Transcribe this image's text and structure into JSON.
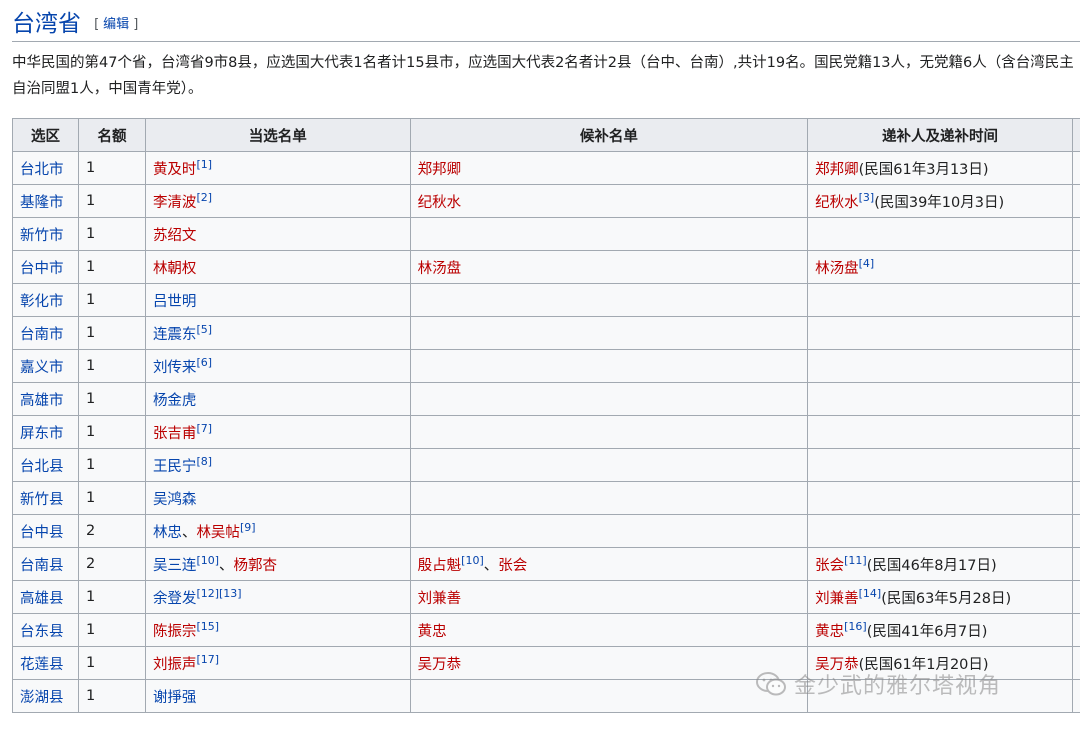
{
  "heading": {
    "title": "台湾省",
    "edit_open": "[",
    "edit_label": "编辑",
    "edit_close": "]"
  },
  "intro": "中华民国的第47个省，台湾省9市8县，应选国大代表1名者计15县市，应选国大代表2名者计2县（台中、台南）,共计19名。国民党籍13人，无党籍6人（含台湾民主自治同盟1人，中国青年党）。",
  "table": {
    "headers": [
      "选区",
      "名额",
      "当选名单",
      "候补名单",
      "递补人及递补时间"
    ],
    "rows": [
      {
        "district": "台北市",
        "seats": "1",
        "elected": [
          {
            "name": "黄及时",
            "link": "red",
            "ref": "[1]"
          }
        ],
        "alternates": [
          {
            "name": "郑邦卿",
            "link": "red",
            "ref": ""
          }
        ],
        "successor": [
          {
            "name": "郑邦卿",
            "link": "red",
            "ref": ""
          }
        ],
        "successor_note": "(民国61年3月13日)"
      },
      {
        "district": "基隆市",
        "seats": "1",
        "elected": [
          {
            "name": "李清波",
            "link": "red",
            "ref": "[2]"
          }
        ],
        "alternates": [
          {
            "name": "纪秋水",
            "link": "red",
            "ref": ""
          }
        ],
        "successor": [
          {
            "name": "纪秋水",
            "link": "red",
            "ref": "[3]"
          }
        ],
        "successor_note": "(民国39年10月3日)"
      },
      {
        "district": "新竹市",
        "seats": "1",
        "elected": [
          {
            "name": "苏绍文",
            "link": "red",
            "ref": ""
          }
        ],
        "alternates": [],
        "successor": [],
        "successor_note": ""
      },
      {
        "district": "台中市",
        "seats": "1",
        "elected": [
          {
            "name": "林朝权",
            "link": "red",
            "ref": ""
          }
        ],
        "alternates": [
          {
            "name": "林汤盘",
            "link": "red",
            "ref": ""
          }
        ],
        "successor": [
          {
            "name": "林汤盘",
            "link": "red",
            "ref": "[4]"
          }
        ],
        "successor_note": ""
      },
      {
        "district": "彰化市",
        "seats": "1",
        "elected": [
          {
            "name": "吕世明",
            "link": "blue",
            "ref": ""
          }
        ],
        "alternates": [],
        "successor": [],
        "successor_note": ""
      },
      {
        "district": "台南市",
        "seats": "1",
        "elected": [
          {
            "name": "连震东",
            "link": "blue",
            "ref": "[5]"
          }
        ],
        "alternates": [],
        "successor": [],
        "successor_note": ""
      },
      {
        "district": "嘉义市",
        "seats": "1",
        "elected": [
          {
            "name": "刘传来",
            "link": "blue",
            "ref": "[6]"
          }
        ],
        "alternates": [],
        "successor": [],
        "successor_note": ""
      },
      {
        "district": "高雄市",
        "seats": "1",
        "elected": [
          {
            "name": "杨金虎",
            "link": "blue",
            "ref": ""
          }
        ],
        "alternates": [],
        "successor": [],
        "successor_note": ""
      },
      {
        "district": "屏东市",
        "seats": "1",
        "elected": [
          {
            "name": "张吉甫",
            "link": "red",
            "ref": "[7]"
          }
        ],
        "alternates": [],
        "successor": [],
        "successor_note": ""
      },
      {
        "district": "台北县",
        "seats": "1",
        "elected": [
          {
            "name": "王民宁",
            "link": "blue",
            "ref": "[8]"
          }
        ],
        "alternates": [],
        "successor": [],
        "successor_note": ""
      },
      {
        "district": "新竹县",
        "seats": "1",
        "elected": [
          {
            "name": "吴鸿森",
            "link": "blue",
            "ref": ""
          }
        ],
        "alternates": [],
        "successor": [],
        "successor_note": ""
      },
      {
        "district": "台中县",
        "seats": "2",
        "elected": [
          {
            "name": "林忠",
            "link": "blue",
            "ref": ""
          },
          {
            "name": "林吴帖",
            "link": "red",
            "ref": "[9]"
          }
        ],
        "alternates": [],
        "successor": [],
        "successor_note": ""
      },
      {
        "district": "台南县",
        "seats": "2",
        "elected": [
          {
            "name": "吴三连",
            "link": "blue",
            "ref": "[10]"
          },
          {
            "name": "杨郭杏",
            "link": "red",
            "ref": ""
          }
        ],
        "alternates": [
          {
            "name": "殷占魁",
            "link": "red",
            "ref": "[10]"
          },
          {
            "name": "张会",
            "link": "red",
            "ref": ""
          }
        ],
        "successor": [
          {
            "name": "张会",
            "link": "red",
            "ref": "[11]"
          }
        ],
        "successor_note": "(民国46年8月17日)"
      },
      {
        "district": "高雄县",
        "seats": "1",
        "elected": [
          {
            "name": "余登发",
            "link": "blue",
            "ref": "[12][13]"
          }
        ],
        "alternates": [
          {
            "name": "刘兼善",
            "link": "red",
            "ref": ""
          }
        ],
        "successor": [
          {
            "name": "刘兼善",
            "link": "red",
            "ref": "[14]"
          }
        ],
        "successor_note": "(民国63年5月28日)"
      },
      {
        "district": "台东县",
        "seats": "1",
        "elected": [
          {
            "name": "陈振宗",
            "link": "red",
            "ref": "[15]"
          }
        ],
        "alternates": [
          {
            "name": "黄忠",
            "link": "red",
            "ref": ""
          }
        ],
        "successor": [
          {
            "name": "黄忠",
            "link": "red",
            "ref": "[16]"
          }
        ],
        "successor_note": "(民国41年6月7日)"
      },
      {
        "district": "花莲县",
        "seats": "1",
        "elected": [
          {
            "name": "刘振声",
            "link": "red",
            "ref": "[17]"
          }
        ],
        "alternates": [
          {
            "name": "吴万恭",
            "link": "red",
            "ref": ""
          }
        ],
        "successor": [
          {
            "name": "吴万恭",
            "link": "red",
            "ref": ""
          }
        ],
        "successor_note": "(民国61年1月20日)"
      },
      {
        "district": "澎湖县",
        "seats": "1",
        "elected": [
          {
            "name": "谢掙强",
            "link": "blue",
            "ref": ""
          }
        ],
        "alternates": [],
        "successor": [],
        "successor_note": ""
      }
    ]
  },
  "watermark": {
    "text": "金少武的雅尔塔视角",
    "icon": "wechat-icon"
  },
  "colors": {
    "link_blue": "#0645ad",
    "link_red": "#ba0000",
    "header_bg": "#eaecf0"
  }
}
